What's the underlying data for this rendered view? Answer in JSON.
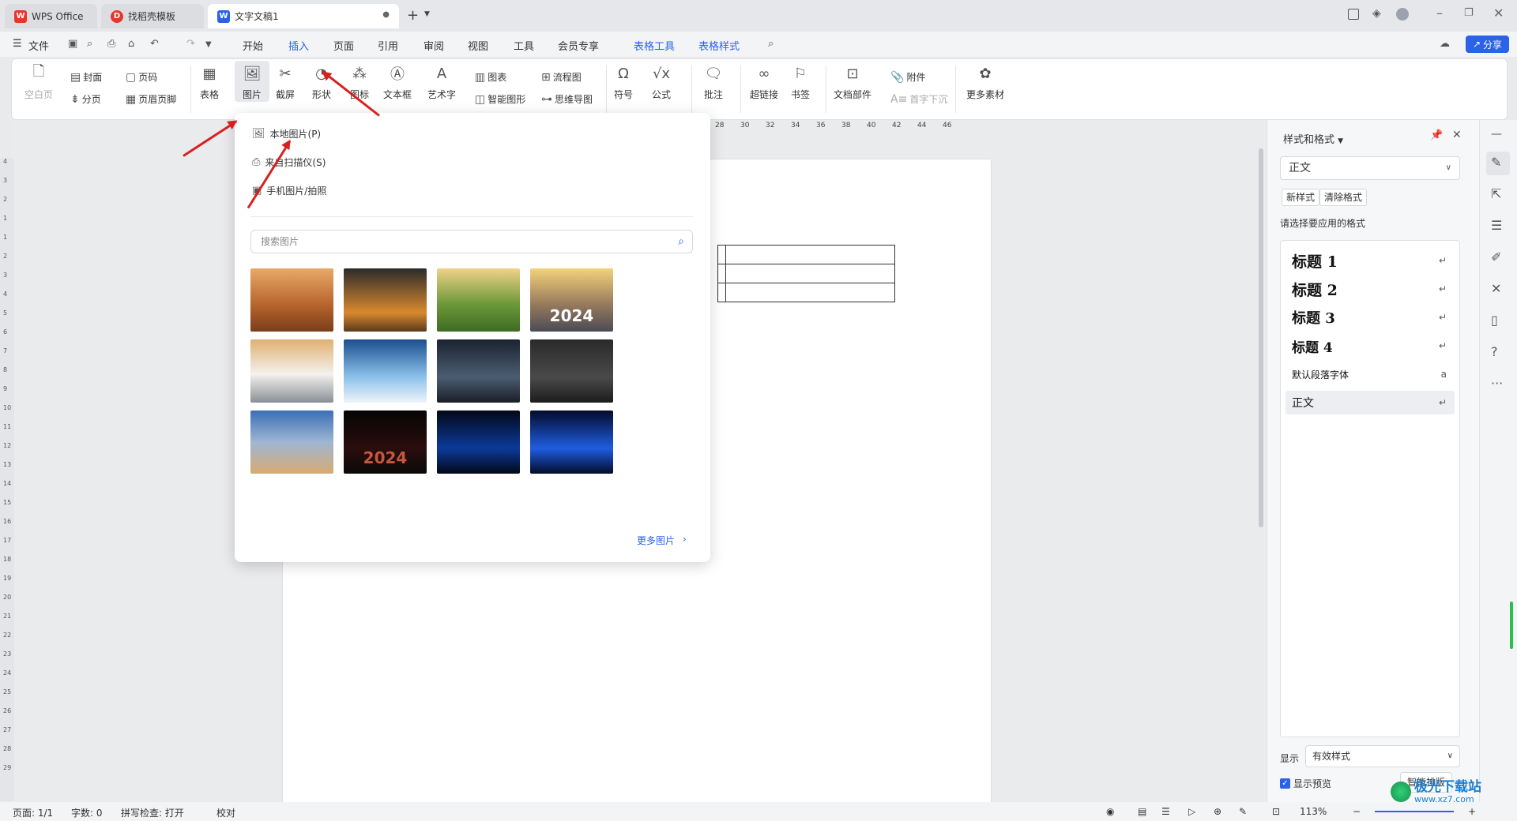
{
  "tabs": [
    {
      "label": "WPS Office"
    },
    {
      "label": "找稻壳模板"
    },
    {
      "label": "文字文稿1"
    }
  ],
  "menu": {
    "file": "文件",
    "items": [
      "开始",
      "插入",
      "页面",
      "引用",
      "审阅",
      "视图",
      "工具",
      "会员专享",
      "表格工具",
      "表格样式"
    ],
    "share": "分享"
  },
  "ribbon": {
    "blank_page": "空白页",
    "cover": "封面",
    "page_break": "分页",
    "page_number": "页码",
    "header_footer": "页眉页脚",
    "table": "表格",
    "picture": "图片",
    "screenshot": "截屏",
    "shape": "形状",
    "icon": "图标",
    "textbox": "文本框",
    "wordart": "艺术字",
    "chart": "图表",
    "smart_shape": "智能图形",
    "flowchart": "流程图",
    "mindmap": "思维导图",
    "symbol": "符号",
    "formula": "公式",
    "comment": "批注",
    "hyperlink": "超链接",
    "bookmark": "书签",
    "doc_parts": "文档部件",
    "attachment": "附件",
    "dropcap": "首字下沉",
    "more_material": "更多素材"
  },
  "ruler_ticks": [
    "28",
    "30",
    "32",
    "34",
    "36",
    "38",
    "40",
    "42",
    "44",
    "46"
  ],
  "vruler_ticks": [
    "4",
    "3",
    "2",
    "1",
    "1",
    "2",
    "3",
    "4",
    "5",
    "6",
    "7",
    "8",
    "9",
    "10",
    "11",
    "12",
    "13",
    "14",
    "15",
    "16",
    "17",
    "18",
    "19",
    "20",
    "21",
    "22",
    "23",
    "24",
    "25",
    "26",
    "27",
    "28",
    "29"
  ],
  "dropdown": {
    "local_picture": "本地图片(P)",
    "scanner": "来自扫描仪(S)",
    "phone": "手机图片/拍照",
    "search_placeholder": "搜索图片",
    "more": "更多图片",
    "thumb_texts": [
      "",
      "",
      "",
      "2024",
      "",
      "",
      "",
      "",
      "",
      "2024",
      "",
      ""
    ]
  },
  "panel": {
    "title": "样式和格式",
    "current_style": "正文",
    "new_style": "新样式",
    "clear_format": "清除格式",
    "prompt": "请选择要应用的格式",
    "styles": [
      {
        "label": "标题  1"
      },
      {
        "label": "标题  2"
      },
      {
        "label": "标题  3"
      },
      {
        "label": "标题  4"
      },
      {
        "label": "默认段落字体"
      },
      {
        "label": "正文"
      }
    ],
    "show_label": "显示",
    "show_value": "有效样式",
    "preview_label": "显示预览",
    "smart_layout": "智能排版"
  },
  "status": {
    "page": "页面: 1/1",
    "words": "字数: 0",
    "spell": "拼写检查: 打开",
    "proof": "校对",
    "zoom": "113%"
  },
  "watermark": "极光下载站",
  "watermark_url": "www.xz7.com",
  "colors": {
    "accent": "#2a62e8",
    "arrow": "#d8211f",
    "wps_red": "#e9352b"
  }
}
